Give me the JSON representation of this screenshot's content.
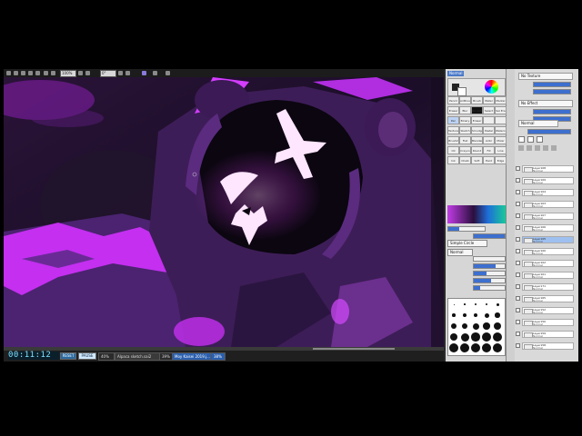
{
  "toolbar": {
    "zoom_value": "100%",
    "angle_value": "0°",
    "icons": [
      "new-file-icon",
      "open-icon",
      "save-icon",
      "undo-icon",
      "redo-icon",
      "select-icon",
      "zoom-icon",
      "rotate-icon",
      "flip-icon",
      "stabilizer-icon"
    ]
  },
  "recording": {
    "timer": "00:11:12",
    "start_label": "RESET",
    "pause_label": "PAUSE"
  },
  "tasks": [
    {
      "label": "40%",
      "active": false
    },
    {
      "label": "Alpaca sketch.sai2",
      "active": false
    },
    {
      "label": "39%",
      "active": false
    },
    {
      "label": "Moy Kaisei 2019.j...",
      "active": true
    },
    {
      "label": "38%",
      "active": true
    }
  ],
  "tools": {
    "tab_label": "Normal",
    "grid": [
      [
        "Pencil",
        "AirBrush",
        "Brush",
        "Water",
        "Marker"
      ],
      [
        "Eraser",
        "Blur",
        "Bucket",
        "Select",
        "Sel Era"
      ],
      [
        "Pen",
        "Binary",
        "Eraser",
        "",
        ""
      ],
      [
        "Texture",
        "Sketch",
        "Smudge",
        "Pastel",
        "Watercol"
      ],
      [
        "Brush2",
        "Flat",
        "Blender",
        "Airbr",
        "Mixer"
      ],
      [
        "Oil",
        "Crayon",
        "Round",
        "Fill",
        "Line"
      ],
      [
        "Ink",
        "Chalk",
        "Soft",
        "Hard",
        "Edge"
      ]
    ],
    "selected_index": 10,
    "black_index": 7,
    "blend_label": "Simple Circle",
    "size_value": "18.0",
    "min_size": "0%",
    "density": "100",
    "brush_mode": "Normal"
  },
  "layers_panel": {
    "texture": "No Texture",
    "effect": "No Effect",
    "blend_mode": "Normal",
    "opacity": "100%",
    "items": [
      {
        "name": "Layer108",
        "mode": "Normal",
        "selected": false
      },
      {
        "name": "Layer109",
        "mode": "Normal",
        "selected": false
      },
      {
        "name": "Layer104",
        "mode": "Normal",
        "selected": false
      },
      {
        "name": "Layer103",
        "mode": "Normal",
        "selected": false
      },
      {
        "name": "Layer107",
        "mode": "Normal",
        "selected": false
      },
      {
        "name": "Layer106",
        "mode": "Normal",
        "selected": false
      },
      {
        "name": "Layer105",
        "mode": "Normal",
        "selected": true
      },
      {
        "name": "Layer100",
        "mode": "Normal",
        "selected": false
      },
      {
        "name": "Layer102",
        "mode": "Normal",
        "selected": false
      },
      {
        "name": "Layer101",
        "mode": "Normal",
        "selected": false
      },
      {
        "name": "Layer171",
        "mode": "Normal",
        "selected": false
      },
      {
        "name": "Layer165",
        "mode": "Normal",
        "selected": false
      },
      {
        "name": "Layer152",
        "mode": "Normal",
        "selected": false
      },
      {
        "name": "Layer150",
        "mode": "Normal",
        "selected": false
      },
      {
        "name": "Layer159",
        "mode": "Normal",
        "selected": false
      },
      {
        "name": "Layer158",
        "mode": "Normal",
        "selected": false
      }
    ]
  },
  "colors": {
    "accent": "#3d6fcf",
    "neon": "#e23bff",
    "glow": "#ff8dff",
    "hood": "#4a2366",
    "shadow": "#1a0f24"
  }
}
